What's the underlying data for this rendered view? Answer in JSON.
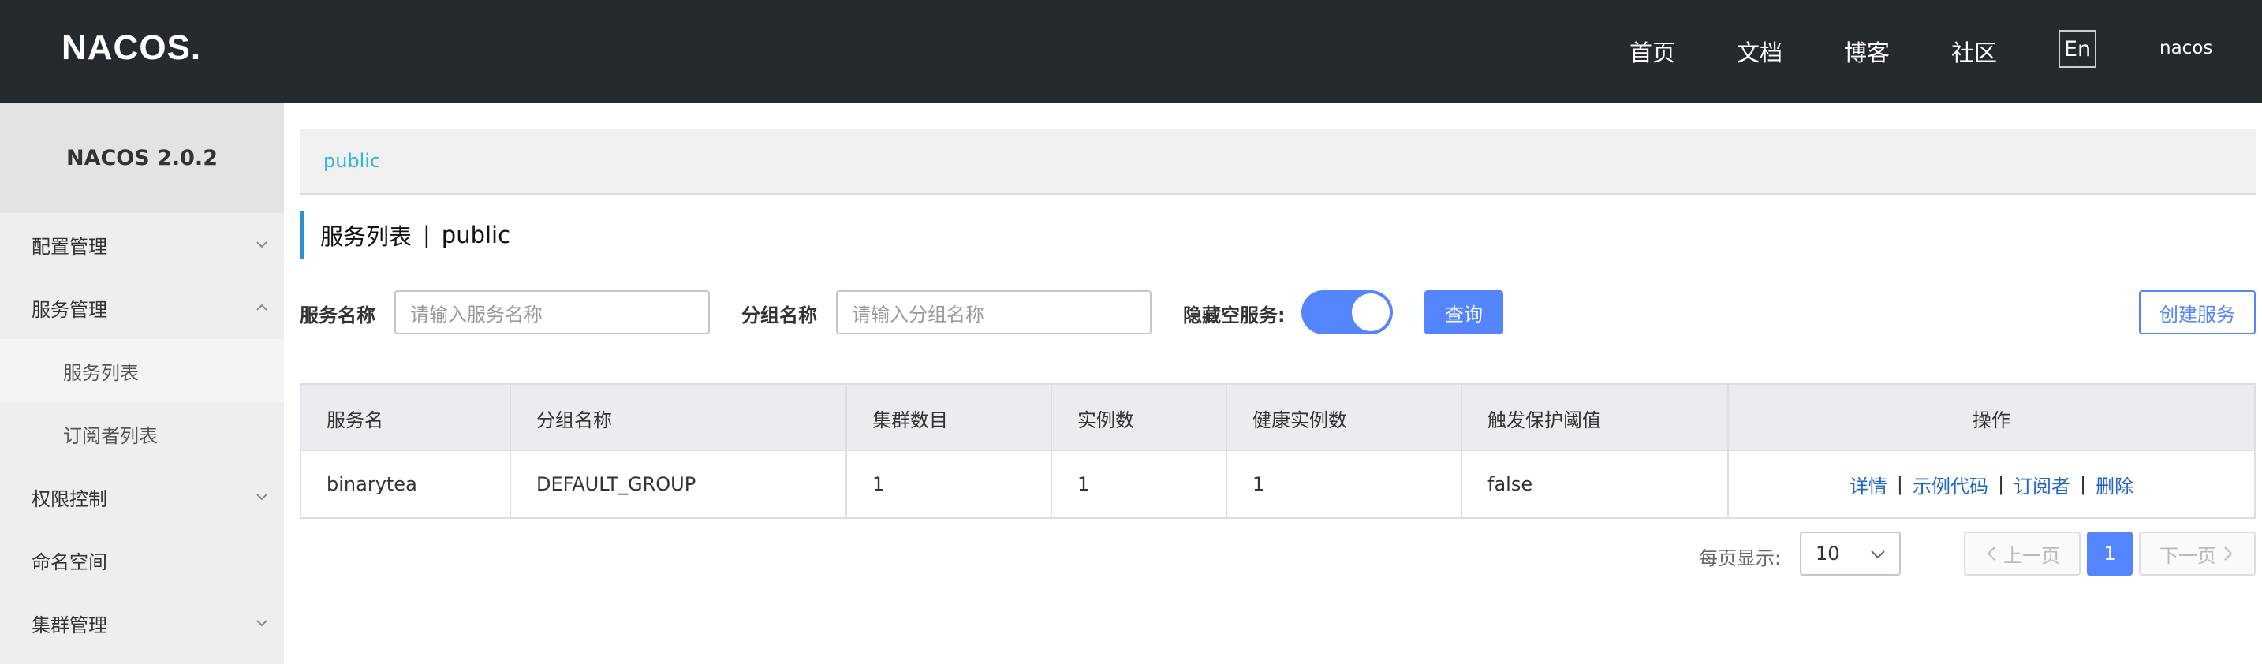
{
  "header": {
    "logo": "NACOS.",
    "nav": [
      {
        "label": "首页"
      },
      {
        "label": "文档"
      },
      {
        "label": "博客"
      },
      {
        "label": "社区"
      }
    ],
    "lang_button": "En",
    "user": "nacos"
  },
  "sidebar": {
    "title": "NACOS 2.0.2",
    "items": [
      {
        "label": "配置管理",
        "expanded": false
      },
      {
        "label": "服务管理",
        "expanded": true
      },
      {
        "label": "服务列表",
        "sub": true,
        "active": true
      },
      {
        "label": "订阅者列表",
        "sub": true
      },
      {
        "label": "权限控制",
        "expanded": false
      },
      {
        "label": "命名空间"
      },
      {
        "label": "集群管理",
        "expanded": false
      }
    ]
  },
  "breadcrumb": "public",
  "page_title": {
    "title": "服务列表",
    "separator": "|",
    "namespace": "public"
  },
  "filters": {
    "service_name_label": "服务名称",
    "service_name_placeholder": "请输入服务名称",
    "group_name_label": "分组名称",
    "group_name_placeholder": "请输入分组名称",
    "hide_empty_label": "隐藏空服务:",
    "hide_empty_on": true,
    "query_button": "查询",
    "create_button": "创建服务"
  },
  "table": {
    "columns": [
      "服务名",
      "分组名称",
      "集群数目",
      "实例数",
      "健康实例数",
      "触发保护阈值",
      "操作"
    ],
    "rows": [
      {
        "service": "binarytea",
        "group": "DEFAULT_GROUP",
        "clusters": "1",
        "instances": "1",
        "healthy": "1",
        "protect": "false"
      }
    ],
    "actions": [
      "详情",
      "示例代码",
      "订阅者",
      "删除"
    ],
    "action_sep": "|"
  },
  "pagination": {
    "per_page_label": "每页显示:",
    "per_page_value": "10",
    "prev": "上一页",
    "current": "1",
    "next": "下一页"
  },
  "colors": {
    "header_bg": "#252a2f",
    "accent": "#5584ff",
    "link": "#2065c4",
    "breadcrumb": "#2fb5d6"
  }
}
